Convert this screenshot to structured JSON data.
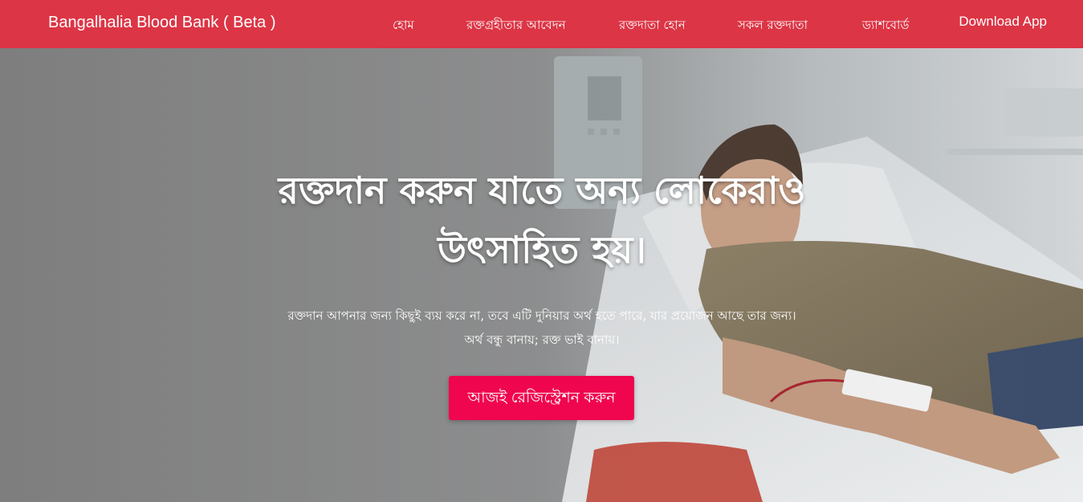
{
  "navbar": {
    "brand": "Bangalhalia Blood Bank ( Beta )",
    "links": [
      {
        "label": "হোম"
      },
      {
        "label": "রক্তগ্রহীতার আবেদন"
      },
      {
        "label": "রক্তদাতা হোন"
      },
      {
        "label": "সকল রক্তদাতা"
      },
      {
        "label": "ড্যাশবোর্ড"
      }
    ],
    "download_app": "Download App"
  },
  "hero": {
    "title_line1": "রক্তদান করুন যাতে অন্য লোকেরাও",
    "title_line2": "উৎসাহিত হয়।",
    "text_line1": "রক্তদান আপনার জন্য কিছুই ব্যয় করে না, তবে এটি দুনিয়ার অর্থ হতে পারে, যার প্রয়োজন আছে তার জন্য।",
    "text_line2": "অর্থ বন্ধু বানায়; রক্ত ভাই বানায়।",
    "cta_label": "আজই রেজিস্ট্রেশন করুন"
  },
  "colors": {
    "navbar": "#dc3545",
    "cta": "#f0054f"
  }
}
